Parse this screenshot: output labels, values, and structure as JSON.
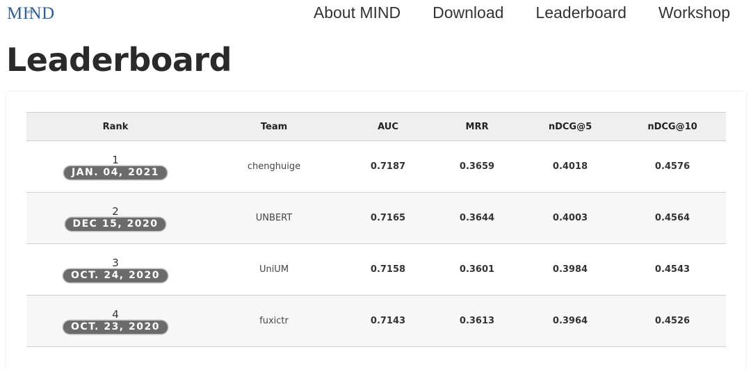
{
  "header": {
    "logo_text": "MIND",
    "logo_mark": "NEW",
    "nav": [
      {
        "label": "About MIND"
      },
      {
        "label": "Download"
      },
      {
        "label": "Leaderboard"
      },
      {
        "label": "Workshop"
      }
    ]
  },
  "page": {
    "title": "Leaderboard"
  },
  "table": {
    "columns": [
      "Rank",
      "Team",
      "AUC",
      "MRR",
      "nDCG@5",
      "nDCG@10"
    ],
    "rows": [
      {
        "rank": "1",
        "date": "JAN. 04, 2021",
        "team": "chenghuige",
        "auc": "0.7187",
        "mrr": "0.3659",
        "ndcg5": "0.4018",
        "ndcg10": "0.4576"
      },
      {
        "rank": "2",
        "date": "DEC 15, 2020",
        "team": "UNBERT",
        "auc": "0.7165",
        "mrr": "0.3644",
        "ndcg5": "0.4003",
        "ndcg10": "0.4564"
      },
      {
        "rank": "3",
        "date": "OCT. 24, 2020",
        "team": "UniUM",
        "auc": "0.7158",
        "mrr": "0.3601",
        "ndcg5": "0.3984",
        "ndcg10": "0.4543"
      },
      {
        "rank": "4",
        "date": "OCT. 23, 2020",
        "team": "fuxictr",
        "auc": "0.7143",
        "mrr": "0.3613",
        "ndcg5": "0.3964",
        "ndcg10": "0.4526"
      }
    ]
  },
  "colors": {
    "logo": "#2f5f98",
    "badge": "#6b6b6b",
    "header_row": "#efefef",
    "stripe": "#f7f7f7"
  }
}
